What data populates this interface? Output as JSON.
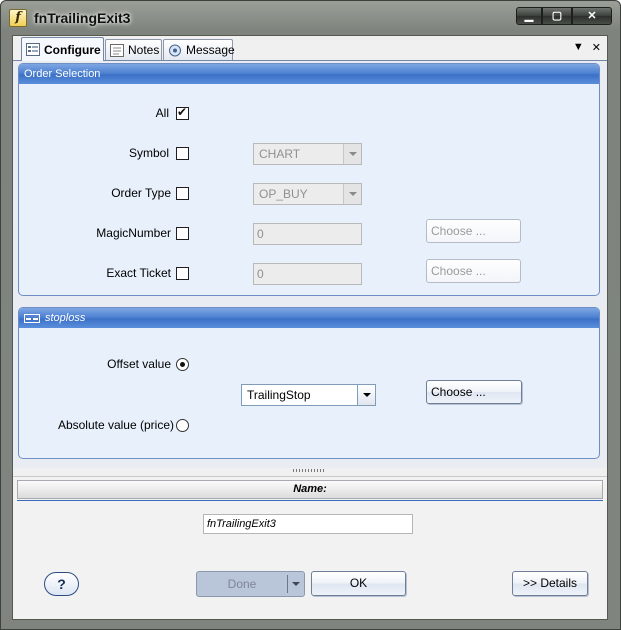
{
  "window": {
    "title": "fnTrailingExit3",
    "icon_letter": "f",
    "controls": [
      "minimize-icon",
      "maximize-icon",
      "close-icon"
    ]
  },
  "tabs": [
    {
      "label": "Configure",
      "icon": "configure-icon",
      "active": true
    },
    {
      "label": "Notes",
      "icon": "notes-icon",
      "active": false
    },
    {
      "label": "Message",
      "icon": "message-icon",
      "active": false
    }
  ],
  "tab_tools": {
    "menu_icon": "▼",
    "close_icon": "✕"
  },
  "order_selection": {
    "title": "Order Selection",
    "all_label": "All",
    "all_checked": true,
    "symbol_label": "Symbol",
    "symbol_value": "CHART",
    "order_type_label": "Order Type",
    "order_type_value": "OP_BUY",
    "magic_label": "MagicNumber",
    "magic_value": "0",
    "magic_choose": "Choose ...",
    "ticket_label": "Exact Ticket",
    "ticket_value": "0",
    "ticket_choose": "Choose ..."
  },
  "stoploss": {
    "title": "stoploss",
    "offset_label": "Offset value",
    "offset_selected": true,
    "offset_combo_value": "TrailingStop",
    "offset_choose": "Choose ...",
    "absolute_label": "Absolute value (price)"
  },
  "name_section": {
    "header": "Name:",
    "value": "fnTrailingExit3"
  },
  "footer": {
    "help_label": "?",
    "done_label": "Done",
    "ok_label": "OK",
    "details_label": ">> Details"
  },
  "colors": {
    "group_header": "#4f82d2",
    "group_body": "#e7f0fb",
    "frame": "#7e847d"
  }
}
